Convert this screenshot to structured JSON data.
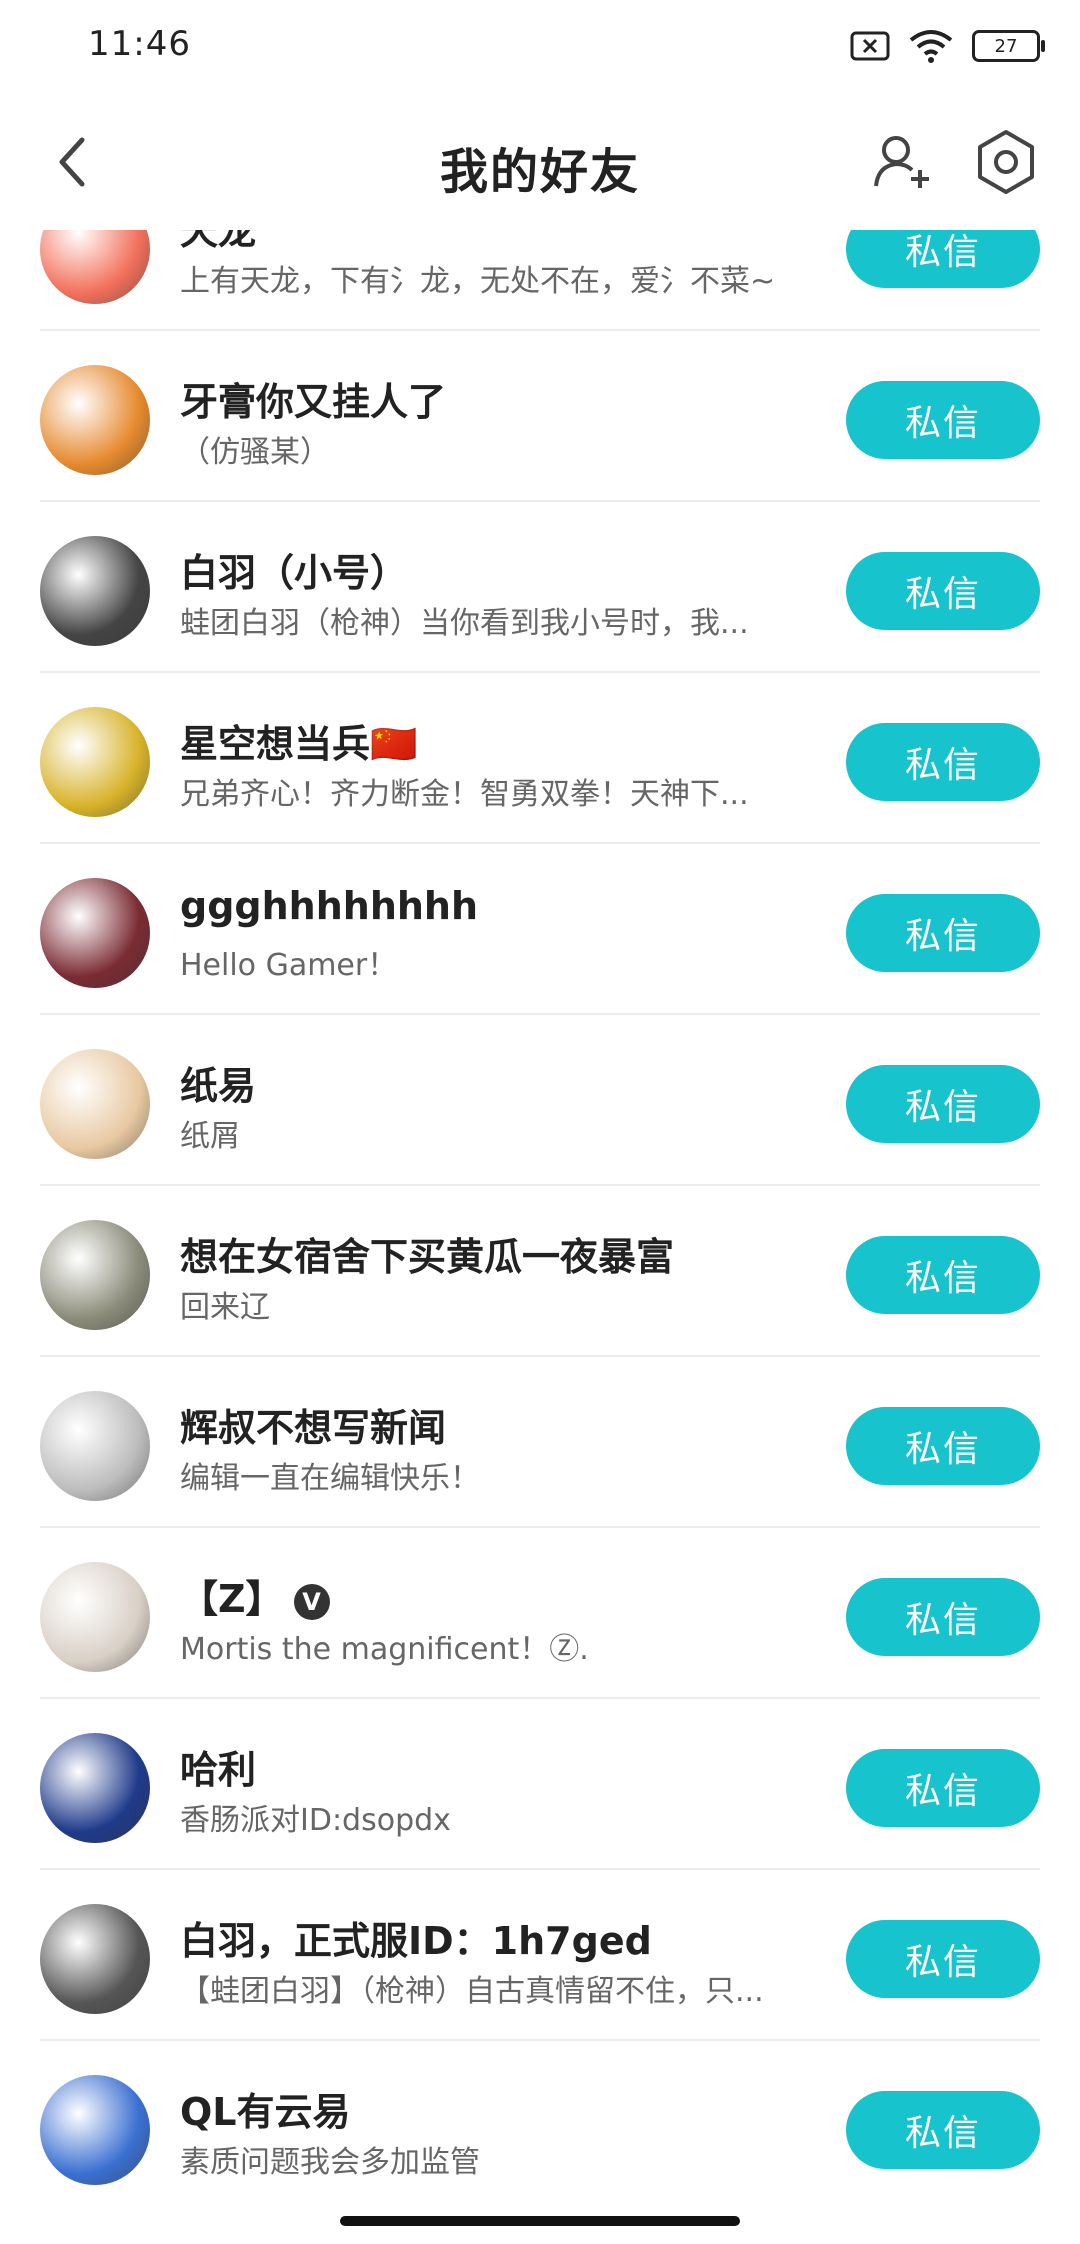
{
  "status": {
    "time": "11:46",
    "battery": "27"
  },
  "header": {
    "title": "我的好友"
  },
  "dm_label": "私信",
  "friends": [
    {
      "name": "天龙",
      "signature": "上有天龙，下有氵龙，无处不在，爱氵不菜~",
      "avatar_color": "#f2705b"
    },
    {
      "name": "牙膏你又挂人了",
      "signature": "（仿骚某）",
      "avatar_color": "#e68a2e"
    },
    {
      "name": "白羽（小号）",
      "signature": "蛙团白羽（枪神）当你看到我小号时，我...",
      "avatar_color": "#444444"
    },
    {
      "name": "星空想当兵🇨🇳",
      "signature": "兄弟齐心！齐力断金！智勇双拳！天神下...",
      "avatar_color": "#d8b32a"
    },
    {
      "name": "ggghhhhhhhh",
      "signature": "Hello Gamer！",
      "avatar_color": "#7a2b33"
    },
    {
      "name": "纸易",
      "signature": "纸屑",
      "avatar_color": "#e8c9a2"
    },
    {
      "name": "想在女宿舍下买黄瓜一夜暴富",
      "signature": "回来辽",
      "avatar_color": "#8b8b7a"
    },
    {
      "name": "辉叔不想写新闻",
      "signature": "编辑一直在编辑快乐！",
      "avatar_color": "#bdbdbd"
    },
    {
      "name": "【Z】",
      "badge": "V",
      "signature": "Mortis the magnificent！Ⓩ.",
      "avatar_color": "#d9d0c6"
    },
    {
      "name": "哈利",
      "signature": "香肠派对ID:dsopdx",
      "avatar_color": "#1f3a8a"
    },
    {
      "name": "白羽，正式服ID：1h7ged",
      "signature": "【蛙团白羽】（枪神）自古真情留不住，只...",
      "avatar_color": "#555555"
    },
    {
      "name": "QL有云易",
      "signature": "素质问题我会多加监管",
      "avatar_color": "#3b6fd1"
    }
  ]
}
